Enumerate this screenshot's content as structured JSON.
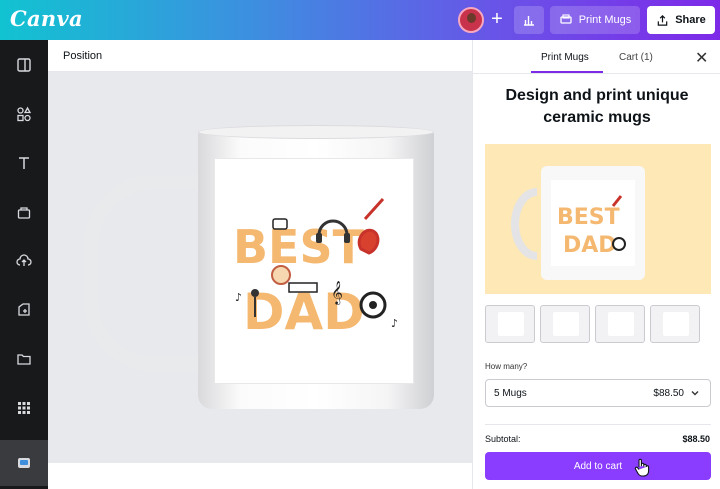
{
  "app": {
    "name": "Canva"
  },
  "header": {
    "print_label": "Print Mugs",
    "share_label": "Share"
  },
  "toolbar": {
    "title": "Position"
  },
  "panel": {
    "tabs": [
      {
        "label": "Print Mugs"
      },
      {
        "label": "Cart (1)"
      }
    ],
    "headline": "Design and print unique ceramic mugs",
    "how_many_label": "How many?",
    "quantity": {
      "selected": "5 Mugs",
      "price": "$88.50"
    },
    "subtotal_label": "Subtotal:",
    "subtotal_value": "$88.50",
    "add_to_cart": "Add to cart"
  },
  "design": {
    "words": [
      "BEST",
      "DAD"
    ]
  },
  "colors": {
    "accent": "#8b3dff",
    "preview_bg": "#fde8b6",
    "design_orange": "#f4b870"
  },
  "icons": [
    "plus-icon",
    "chart-icon",
    "print-icon",
    "share-icon",
    "close-icon",
    "chevron-down-icon"
  ]
}
